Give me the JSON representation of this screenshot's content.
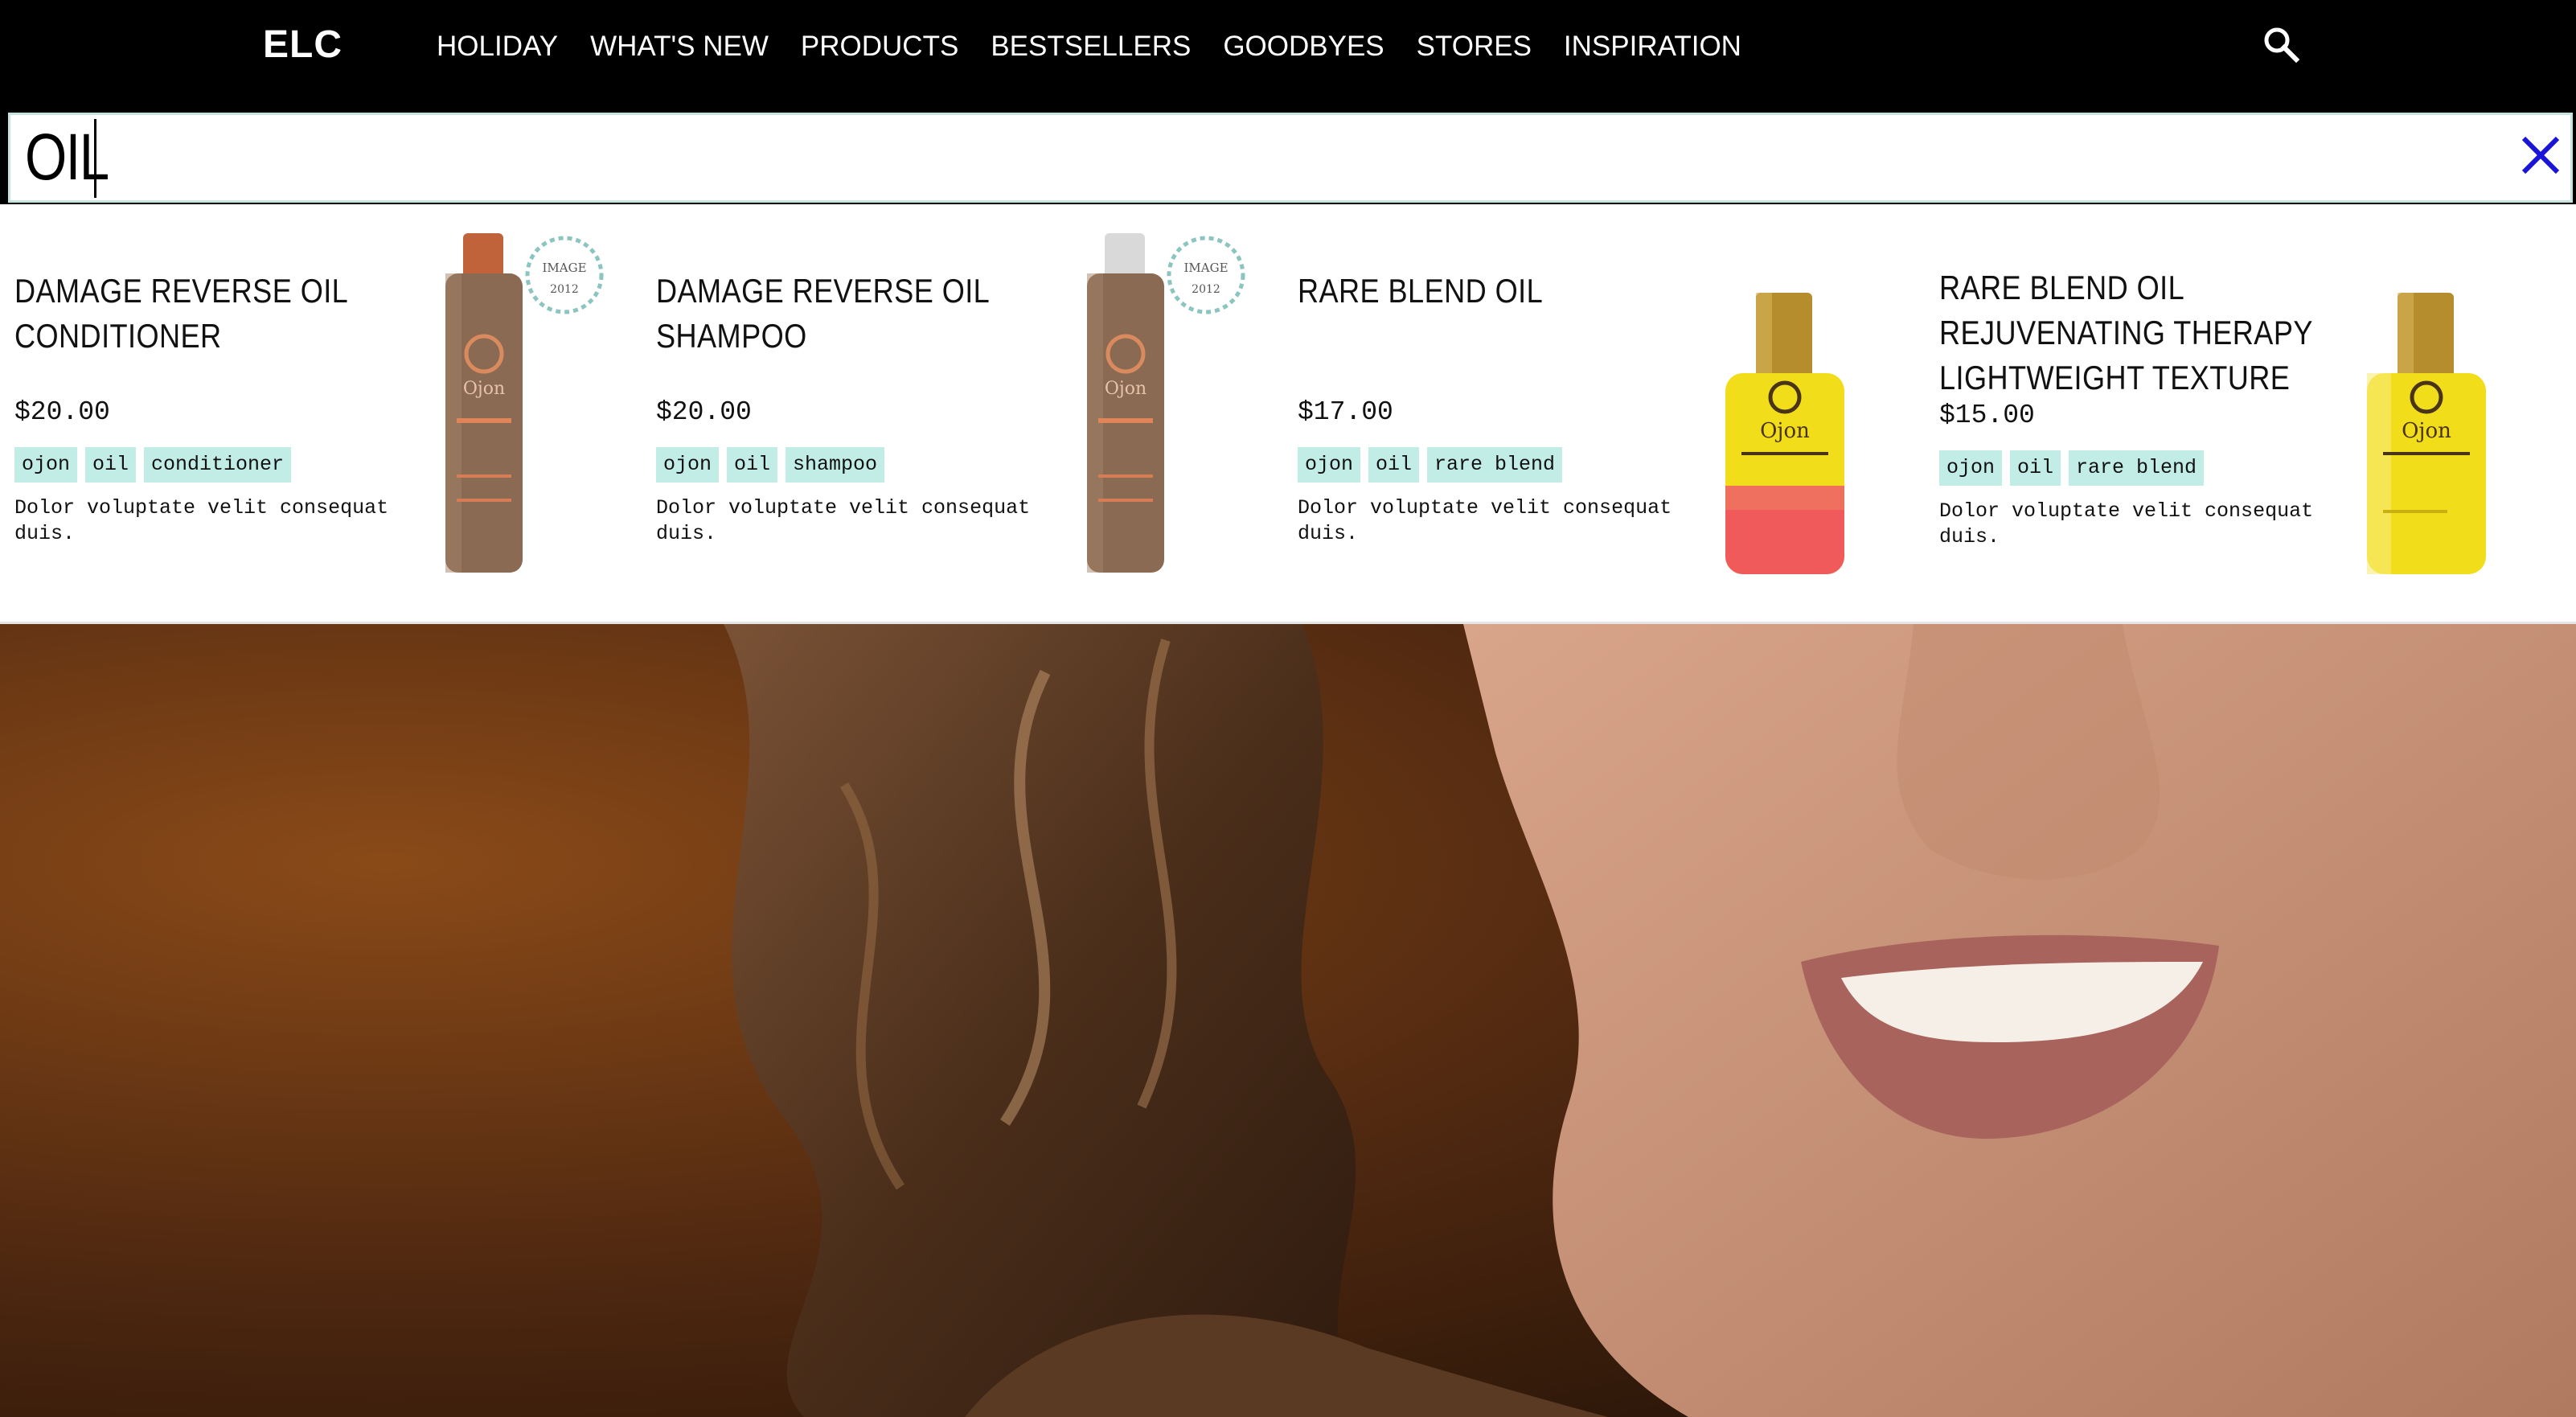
{
  "header": {
    "logo": "ELC",
    "nav": [
      {
        "label": "HOLIDAY"
      },
      {
        "label": "WHAT'S NEW"
      },
      {
        "label": "PRODUCTS"
      },
      {
        "label": "BESTSELLERS"
      },
      {
        "label": "GOODBYES"
      },
      {
        "label": "STORES"
      },
      {
        "label": "INSPIRATION"
      }
    ],
    "search_icon": "search-icon"
  },
  "search": {
    "value": "OIL",
    "clear_icon": "close-icon",
    "accent_color": "#1a14d8"
  },
  "results": [
    {
      "title": "DAMAGE REVERSE OIL CONDITIONER",
      "price": "$20.00",
      "tags": [
        "ojon",
        "oil",
        "conditioner"
      ],
      "description": "Dolor voluptate velit consequat duis.",
      "bottle": "conditioner-bottle",
      "award": "IMAGE"
    },
    {
      "title": "DAMAGE REVERSE OIL SHAMPOO",
      "price": "$20.00",
      "tags": [
        "ojon",
        "oil",
        "shampoo"
      ],
      "description": "Dolor voluptate velit consequat duis.",
      "bottle": "shampoo-bottle",
      "award": "IMAGE"
    },
    {
      "title": "RARE BLEND OIL",
      "price": "$17.00",
      "tags": [
        "ojon",
        "oil",
        "rare blend"
      ],
      "description": "Dolor voluptate velit consequat duis.",
      "bottle": "oil-bottle-red"
    },
    {
      "title": "RARE BLEND OIL REJUVENATING THERAPY LIGHTWEIGHT TEXTURE",
      "price": "$15.00",
      "tags": [
        "ojon",
        "oil",
        "rare blend"
      ],
      "description": "Dolor voluptate velit consequat duis.",
      "bottle": "oil-bottle-yellow"
    }
  ],
  "colors": {
    "tag_bg": "#c2ece6",
    "header_bg": "#000000",
    "search_border": "#c7e4e0"
  }
}
